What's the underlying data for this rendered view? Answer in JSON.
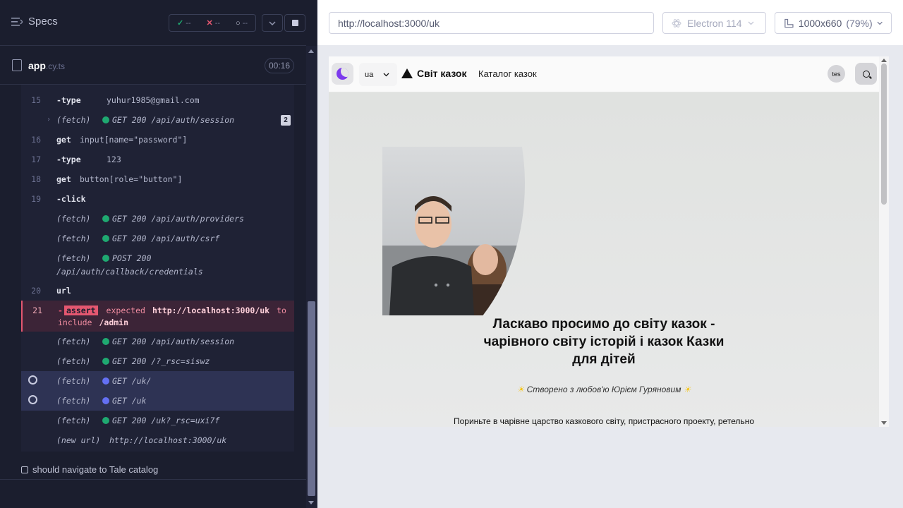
{
  "runner": {
    "specs_label": "Specs",
    "stats": {
      "passed": "--",
      "failed": "--",
      "pending": "--"
    },
    "spec_file": {
      "name": "app",
      "ext": ".cy.ts",
      "timer": "00:16"
    },
    "commands": [
      {
        "num": "15",
        "name": "-type",
        "msg": "yuhur1985@gmail.com",
        "kind": "cmd"
      },
      {
        "num": "",
        "name": "(fetch)",
        "msg": "GET 200 /api/auth/session",
        "kind": "fetch",
        "dot": "green",
        "count": "2"
      },
      {
        "num": "16",
        "name": "get",
        "msg": "input[name=\"password\"]",
        "kind": "cmd"
      },
      {
        "num": "17",
        "name": "-type",
        "msg": "123",
        "kind": "cmd"
      },
      {
        "num": "18",
        "name": "get",
        "msg": "button[role=\"button\"]",
        "kind": "cmd"
      },
      {
        "num": "19",
        "name": "-click",
        "msg": "",
        "kind": "cmd"
      },
      {
        "num": "",
        "name": "(fetch)",
        "msg": "GET 200 /api/auth/providers",
        "kind": "fetch",
        "dot": "green"
      },
      {
        "num": "",
        "name": "(fetch)",
        "msg": "GET 200 /api/auth/csrf",
        "kind": "fetch",
        "dot": "green"
      },
      {
        "num": "",
        "name": "(fetch)",
        "msg": "POST 200",
        "msg2": "/api/auth/callback/credentials",
        "kind": "fetch",
        "dot": "green"
      },
      {
        "num": "20",
        "name": "url",
        "msg": "",
        "kind": "cmd"
      },
      {
        "num": "21",
        "name": "-",
        "assert_tag": "assert",
        "msg": "expected",
        "url": "http://localhost:3000/uk",
        "to": "to",
        "line2a": "include",
        "line2b": "/admin",
        "kind": "assert"
      },
      {
        "num": "",
        "name": "(fetch)",
        "msg": "GET 200 /api/auth/session",
        "kind": "fetch",
        "dot": "green"
      },
      {
        "num": "",
        "name": "(fetch)",
        "msg": "GET 200 /?_rsc=siswz",
        "kind": "fetch",
        "dot": "green"
      },
      {
        "num": "",
        "name": "(fetch)",
        "msg": "GET /uk/",
        "kind": "pending",
        "dot": "blue"
      },
      {
        "num": "",
        "name": "(fetch)",
        "msg": "GET /uk",
        "kind": "pending",
        "dot": "blue"
      },
      {
        "num": "",
        "name": "(fetch)",
        "msg": "GET 200 /uk?_rsc=uxi7f",
        "kind": "fetch",
        "dot": "green"
      },
      {
        "num": "",
        "name": "(new url)",
        "msg": "http://localhost:3000/uk",
        "kind": "fetch"
      }
    ],
    "next_test": "should navigate to Tale catalog"
  },
  "aut": {
    "url": "http://localhost:3000/uk",
    "browser": "Electron 114",
    "viewport": "1000x660",
    "zoom": "(79%)"
  },
  "app": {
    "lang": "ua",
    "brand": "Світ казок",
    "nav_catalog": "Каталог казок",
    "avatar": "tes",
    "hero_title": "Ласкаво просимо до світу казок - чарівного світу історій і казок Казки для дітей",
    "hero_sub": "Створено з любов'ю Юрієм Гуряновим",
    "hero_body": "Пориньте в чарівне царство казкового світу, пристрасного проекту, ретельно"
  },
  "colors": {
    "pass": "#1fa971",
    "fail": "#e45770",
    "pending": "#6470f3",
    "accent_moon": "#7c3aed"
  }
}
